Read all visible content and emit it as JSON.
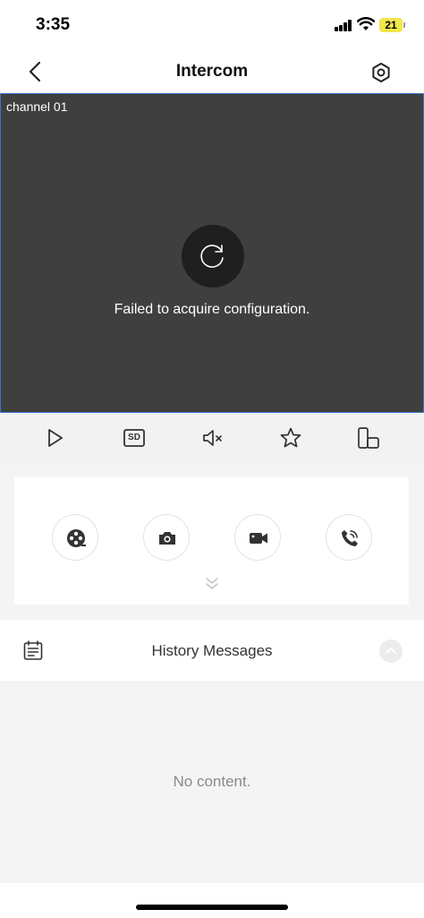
{
  "status_bar": {
    "time": "3:35",
    "battery": "21"
  },
  "nav": {
    "title": "Intercom",
    "back_icon": "chevron-left-icon",
    "settings_icon": "gear-icon"
  },
  "video": {
    "channel": "channel 01",
    "message": "Failed to acquire configuration.",
    "spinner_icon": "refresh-icon"
  },
  "toolbar": {
    "items": [
      {
        "icon": "play-icon"
      },
      {
        "icon": "sd-icon",
        "label": "SD"
      },
      {
        "icon": "mute-icon"
      },
      {
        "icon": "star-icon"
      },
      {
        "icon": "device-switch-icon"
      }
    ]
  },
  "actions": [
    {
      "icon": "film-reel-icon"
    },
    {
      "icon": "camera-icon"
    },
    {
      "icon": "video-camera-icon"
    },
    {
      "icon": "phone-icon"
    }
  ],
  "history": {
    "title": "History Messages",
    "empty": "No content."
  },
  "colors": {
    "video_bg": "#3f3f3f",
    "accent_border": "#3a78c9",
    "toolbar_bg": "#f2f2f2",
    "battery": "#f2e64b"
  }
}
